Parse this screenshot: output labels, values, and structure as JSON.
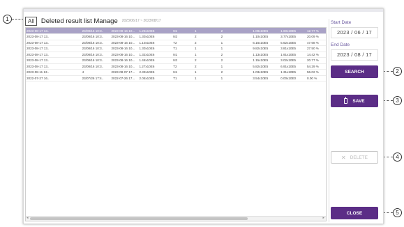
{
  "header": {
    "all_label": "All",
    "title": "Deleted result list Manage",
    "date_range": "2023/06/17 ~ 2023/08/17"
  },
  "table": {
    "selected_index": 0,
    "rows": [
      [
        "2023-08-17 13..",
        "23/08/16 10:3..",
        "2023-08-16 10...",
        "1.25x10E6",
        "N1",
        "1",
        "2",
        "1.08x10E5",
        "1.60x10E5",
        "12.77 %"
      ],
      [
        "2023-08-17 13..",
        "23/08/16 10:3..",
        "2023-08-16 10...",
        "1.30x10E6",
        "N2",
        "2",
        "2",
        "1.10x10E5",
        "3.77x10E5",
        "20.09 %"
      ],
      [
        "2023-08-17 13..",
        "23/08/16 10:3..",
        "2023-08-16 10...",
        "1.10x10E6",
        "T2",
        "2",
        "1",
        "6.16x10E5",
        "5.62x10E5",
        "47.68 %"
      ],
      [
        "2023-08-17 13..",
        "23/08/16 10:3..",
        "2023-08-16 10...",
        "1.30x10E6",
        "T1",
        "1",
        "1",
        "9.82x10E5",
        "3.81x10E5",
        "27.50 %"
      ],
      [
        "2023-08-17 13..",
        "23/08/16 10:3..",
        "2023-08-16 10...",
        "1.32x10E6",
        "N1",
        "1",
        "2",
        "1.13x10E5",
        "1.91x10E5",
        "14.42 %"
      ],
      [
        "2023-08-17 13..",
        "23/08/16 10:3..",
        "2023-08-16 10...",
        "1.46x10E6",
        "N2",
        "2",
        "2",
        "1.15x10E5",
        "3.02x10E5",
        "20.77 %"
      ],
      [
        "2023-08-17 13..",
        "23/08/16 10:3..",
        "2023-08-16 10...",
        "1.27x10E6",
        "T2",
        "2",
        "1",
        "5.82x10E5",
        "6.91x10E5",
        "54.29 %"
      ],
      [
        "2023-08-11 13..",
        "4",
        "2023-08-07 17...",
        "2.33x10E6",
        "N1",
        "1",
        "2",
        "1.03x10E5",
        "1.31x10E5",
        "56.02 %"
      ],
      [
        "2022-07-27 16..",
        "23/07/26 17:4..",
        "2022-07-26 17...",
        "2.05x10E5",
        "T1",
        "1",
        "1",
        "3.54x10E5",
        "0.00x10E0",
        "0.00 %"
      ]
    ]
  },
  "panel": {
    "start_label": "Start Date",
    "start_value": "2023 / 06 / 17",
    "end_label": "End Date",
    "end_value": "2023 / 08 / 17",
    "search_label": "SEARCH",
    "save_label": "SAVE",
    "delete_label": "DELETE",
    "close_label": "CLOSE"
  },
  "callouts": [
    "1",
    "2",
    "3",
    "4",
    "5"
  ],
  "colors": {
    "primary": "#5b2d86",
    "selected_row": "#a9a2c6",
    "label_purple": "#6b5aa0"
  },
  "icons": {
    "save": "battery-save-icon",
    "delete": "x-delete-icon"
  }
}
